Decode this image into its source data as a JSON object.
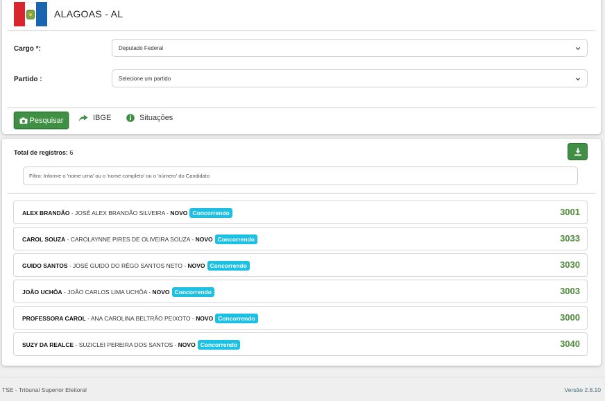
{
  "header": {
    "state_title": "ALAGOAS - AL"
  },
  "form": {
    "cargo_label": "Cargo *:",
    "cargo_value": "Deputado Federal",
    "partido_label": "Partido :",
    "partido_value": "Selecione um partido"
  },
  "toolbar": {
    "search_label": "Pesquisar",
    "ibge_label": "IBGE",
    "situacoes_label": "Situações"
  },
  "results": {
    "total_label": "Total de registros:",
    "total_value": "6",
    "filter_placeholder": "Filtro: Informe o 'nome urna' ou o 'nome completo' ou o 'número' do Candidato",
    "candidates": [
      {
        "urn_name": "ALEX BRANDÃO",
        "full_name": " - JOSÉ ALEX BRANDÃO SILVEIRA - ",
        "party": "NOVO",
        "status": "Concorrendo",
        "number": "3001"
      },
      {
        "urn_name": "CAROL SOUZA",
        "full_name": " - CAROLAYNNE PIRES DE OLIVEIRA SOUZA - ",
        "party": "NOVO",
        "status": "Concorrendo",
        "number": "3033"
      },
      {
        "urn_name": "GUIDO SANTOS",
        "full_name": " - JOSÉ GUIDO DO RÊGO SANTOS NETO - ",
        "party": "NOVO",
        "status": "Concorrendo",
        "number": "3030"
      },
      {
        "urn_name": "JOÃO UCHÔA",
        "full_name": " - JOÃO CARLOS LIMA UCHÔA - ",
        "party": "NOVO",
        "status": "Concorrendo",
        "number": "3003"
      },
      {
        "urn_name": "PROFESSORA CAROL",
        "full_name": " - ANA CAROLINA BELTRÃO PEIXOTO - ",
        "party": "NOVO",
        "status": "Concorrendo",
        "number": "3000"
      },
      {
        "urn_name": "SUZY DA REALCE",
        "full_name": " - SUZICLEI PEREIRA DOS SANTOS - ",
        "party": "NOVO",
        "status": "Concorrendo",
        "number": "3040"
      }
    ]
  },
  "footer": {
    "left": "TSE - Tribunal Superior Eleitoral",
    "right": "Versão 2.8.10"
  },
  "colors": {
    "primary_button": "#3f8f45",
    "badge": "#1cc0e3",
    "candidate_number": "#4f8b3b"
  },
  "icons": {
    "cargo_select": "chevron-down-icon",
    "partido_select": "chevron-down-icon",
    "search_button": "camera-icon",
    "ibge_link": "share-arrow-icon",
    "situacoes_link": "info-circle-icon",
    "download_button": "download-icon"
  }
}
